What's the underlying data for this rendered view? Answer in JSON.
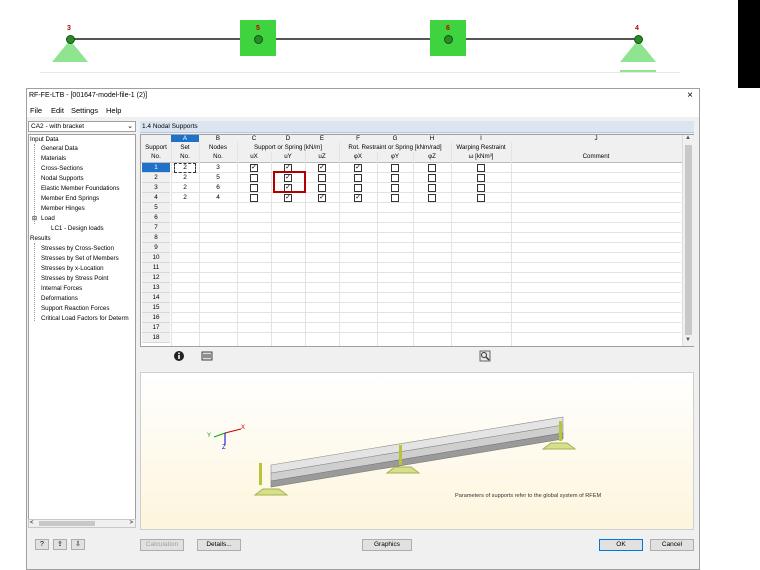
{
  "structure": {
    "nodes": [
      "3",
      "5",
      "6",
      "4"
    ]
  },
  "window": {
    "title": "RF-FE-LTB - [001647-model-file-1 (2)]",
    "close": "×"
  },
  "menu": [
    "File",
    "Edit",
    "Settings",
    "Help"
  ],
  "case_select": {
    "value": "CA2 - with bracket",
    "arrow": "⌄"
  },
  "nav": {
    "input_root": "Input Data",
    "input_items": [
      "General Data",
      "Materials",
      "Cross-Sections",
      "Nodal Supports",
      "Elastic Member Foundations",
      "Member End Springs",
      "Member Hinges"
    ],
    "load": "Load",
    "load_case": "LC1 - Design loads",
    "results_root": "Results",
    "results_items": [
      "Stresses by Cross-Section",
      "Stresses by Set of Members",
      "Stresses by x-Location",
      "Stresses by Stress Point",
      "Internal Forces",
      "Deformations",
      "Support Reaction Forces",
      "Critical Load Factors for Determ"
    ],
    "scroll_left": "<",
    "scroll_right": ">"
  },
  "panel": {
    "title": "1.4 Nodal Supports"
  },
  "table": {
    "col_letters": [
      "A",
      "B",
      "C",
      "D",
      "E",
      "F",
      "G",
      "H",
      "I",
      "J"
    ],
    "group_support": "Support or Spring [kN/m]",
    "group_rot": "Rot. Restraint or Spring [kNm/rad]",
    "group_warp": "Warping Restraint",
    "hdr_support": "Support",
    "hdr_no": "No.",
    "hdr_set": "Set",
    "hdr_set_no": "No.",
    "hdr_nodes": "Nodes",
    "hdr_nodes_no": "No.",
    "hdr_ux": "uX",
    "hdr_uy": "uY",
    "hdr_uz": "uZ",
    "hdr_px": "φX",
    "hdr_py": "φY",
    "hdr_pz": "φZ",
    "hdr_warp": "ω [kNm³]",
    "hdr_comment": "Comment",
    "row_numbers": [
      "1",
      "2",
      "3",
      "4",
      "5",
      "6",
      "7",
      "8",
      "9",
      "10",
      "11",
      "12",
      "13",
      "14",
      "15",
      "16",
      "17",
      "18"
    ],
    "rows": [
      {
        "set": "2",
        "node": "3",
        "ux": true,
        "uy": true,
        "uz": true,
        "px": true,
        "py": false,
        "pz": false,
        "w": false
      },
      {
        "set": "2",
        "node": "5",
        "ux": false,
        "uy": true,
        "uz": false,
        "px": false,
        "py": false,
        "pz": false,
        "w": false
      },
      {
        "set": "2",
        "node": "6",
        "ux": false,
        "uy": true,
        "uz": false,
        "px": false,
        "py": false,
        "pz": false,
        "w": false
      },
      {
        "set": "2",
        "node": "4",
        "ux": false,
        "uy": true,
        "uz": true,
        "px": true,
        "py": false,
        "pz": false,
        "w": false
      }
    ]
  },
  "preview": {
    "axis_x": "X",
    "axis_y": "Y",
    "axis_z": "Z",
    "note": "Parameters of supports refer to the global system of RFEM"
  },
  "buttons": {
    "calculation": "Calculation",
    "details": "Details...",
    "graphics": "Graphics",
    "ok": "OK",
    "cancel": "Cancel"
  },
  "colors": {
    "selected_row": "#1e72c8",
    "highlight_box": "#b00000",
    "support_green": "#3fd43f"
  }
}
